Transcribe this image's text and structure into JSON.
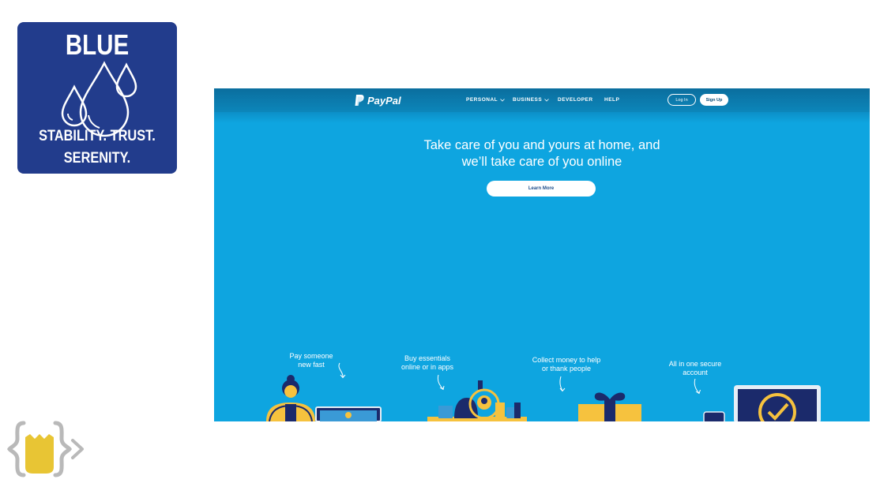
{
  "card": {
    "title": "BLUE",
    "line1": "STABILITY. TRUST.",
    "line2": "SERENITY.",
    "bg_color": "#223c8c",
    "icon": "water-drops-icon"
  },
  "paypal": {
    "logo_text": "PayPal",
    "nav": {
      "personal": "PERSONAL",
      "business": "BUSINESS",
      "developer": "DEVELOPER",
      "help": "HELP"
    },
    "login_label": "Log In",
    "signup_label": "Sign Up",
    "hero_line1": "Take care of you and yours at home, and",
    "hero_line2": "we’ll take care of you online",
    "learn_more": "Learn More",
    "features": [
      {
        "line1": "Pay someone",
        "line2": "new fast"
      },
      {
        "line1": "Buy essentials",
        "line2": "online or in apps"
      },
      {
        "line1": "Collect money to help",
        "line2": "or thank people"
      },
      {
        "line1": "All in one secure",
        "line2": "account"
      }
    ],
    "colors": {
      "hero": "#0ea5e0",
      "nav": "#0b6e9e"
    }
  },
  "footer_logo": {
    "icon": "code-braces-logo-icon",
    "accent": "#e8c534"
  }
}
